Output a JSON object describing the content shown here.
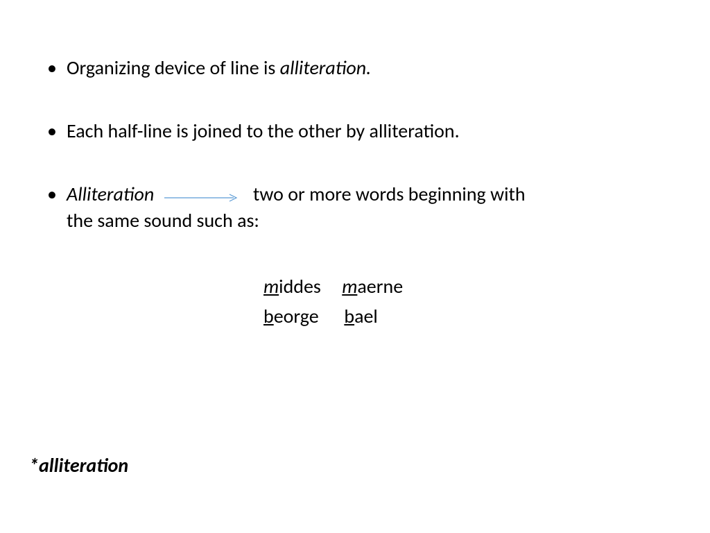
{
  "bullets": {
    "b1_prefix": "Organizing device of line is ",
    "b1_italic": "alliteration.",
    "b2": "Each half-line is joined to the other by alliteration.",
    "b3_italic": "Alliteration",
    "b3_rest_a": "two or more words beginning with",
    "b3_rest_b": "the same sound such as:"
  },
  "examples": {
    "row1": {
      "w1_u": "m",
      "w1_r": "iddes",
      "w2_u": "m",
      "w2_r": "aerne"
    },
    "row2": {
      "w1_u": "b",
      "w1_r": "eorge",
      "w2_u": "b",
      "w2_r": "ael"
    }
  },
  "footnote": "*alliteration",
  "colors": {
    "arrow": "#5b9bd5"
  }
}
